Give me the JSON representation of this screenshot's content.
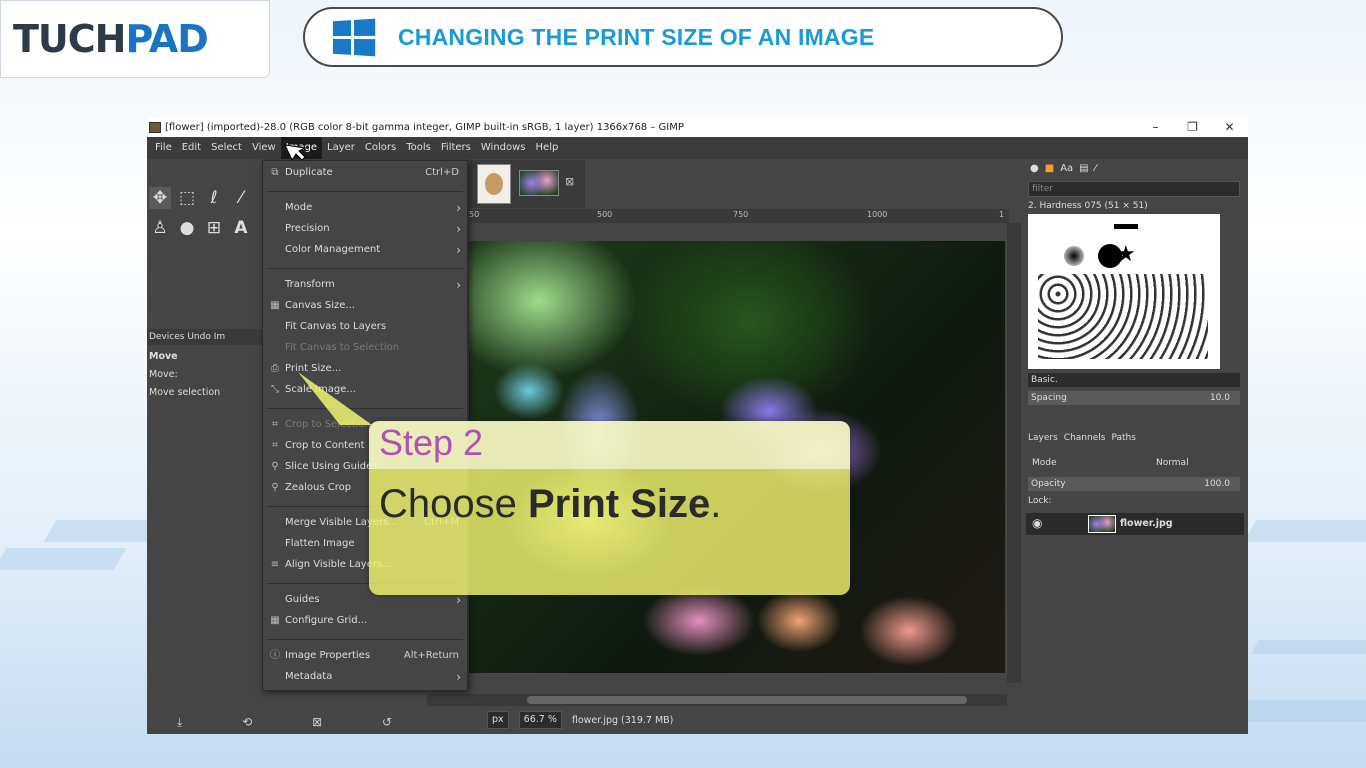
{
  "brand": {
    "logo_part1": "T",
    "logo_part2": "UCH",
    "logo_part3": "PAD",
    "heading": "CHANGING THE PRINT SIZE OF AN IMAGE"
  },
  "gimp": {
    "title": "[flower] (imported)-28.0 (RGB color 8-bit gamma integer, GIMP built-in sRGB, 1 layer) 1366x768 – GIMP",
    "window_controls": [
      "–",
      "❐",
      "✕"
    ],
    "menubar": [
      "File",
      "Edit",
      "Select",
      "View",
      "Image",
      "Layer",
      "Colors",
      "Tools",
      "Filters",
      "Windows",
      "Help"
    ],
    "active_menu": "Image",
    "dock_tabs": "Devices Undo Im",
    "tool_options": {
      "title": "Move",
      "move_label": "Move:",
      "hint": "Move selection"
    },
    "ruler_ticks": [
      "50",
      "500",
      "750",
      "1000",
      "1"
    ],
    "status": {
      "unit": "px",
      "zoom": "66.7 %",
      "file": "flower.jpg (319.7 MB)"
    },
    "brushes": {
      "filter_placeholder": "filter",
      "name": "2. Hardness 075 (51 × 51)",
      "preset": "Basic.",
      "spacing_label": "Spacing",
      "spacing_value": "10.0"
    },
    "layers": {
      "tabs": [
        "Layers",
        "Channels",
        "Paths"
      ],
      "mode_label": "Mode",
      "mode_value": "Normal",
      "opacity_label": "Opacity",
      "opacity_value": "100.0",
      "lock_label": "Lock:",
      "layer_name": "flower.jpg"
    }
  },
  "menu": [
    {
      "label": "Duplicate",
      "shortcut": "Ctrl+D",
      "icon": "duplicate-icon"
    },
    {
      "label": "Mode",
      "sub": true
    },
    {
      "label": "Precision",
      "sub": true
    },
    {
      "label": "Color Management",
      "sub": true
    },
    {
      "label": "Transform",
      "sub": true
    },
    {
      "label": "Canvas Size...",
      "icon": "canvas-icon"
    },
    {
      "label": "Fit Canvas to Layers"
    },
    {
      "label": "Fit Canvas to Selection",
      "disabled": true
    },
    {
      "label": "Print Size...",
      "icon": "printer-icon"
    },
    {
      "label": "Scale Image...",
      "icon": "scale-icon"
    },
    {
      "label": "Crop to Selection",
      "disabled": true,
      "icon": "crop-icon"
    },
    {
      "label": "Crop to Content",
      "icon": "crop-icon"
    },
    {
      "label": "Slice Using Guides",
      "icon": "slice-icon"
    },
    {
      "label": "Zealous Crop",
      "icon": "zealous-icon"
    },
    {
      "label": "Merge Visible Layers...",
      "shortcut": "Ctrl+M"
    },
    {
      "label": "Flatten Image"
    },
    {
      "label": "Align Visible Layers...",
      "icon": "align-icon"
    },
    {
      "label": "Guides",
      "sub": true
    },
    {
      "label": "Configure Grid...",
      "icon": "grid-icon"
    },
    {
      "label": "Image Properties",
      "shortcut": "Alt+Return",
      "icon": "info-icon"
    },
    {
      "label": "Metadata",
      "sub": true
    }
  ],
  "callout": {
    "step": "Step 2",
    "instruction_prefix": "Choose ",
    "instruction_bold": "Print Size",
    "instruction_suffix": "."
  }
}
